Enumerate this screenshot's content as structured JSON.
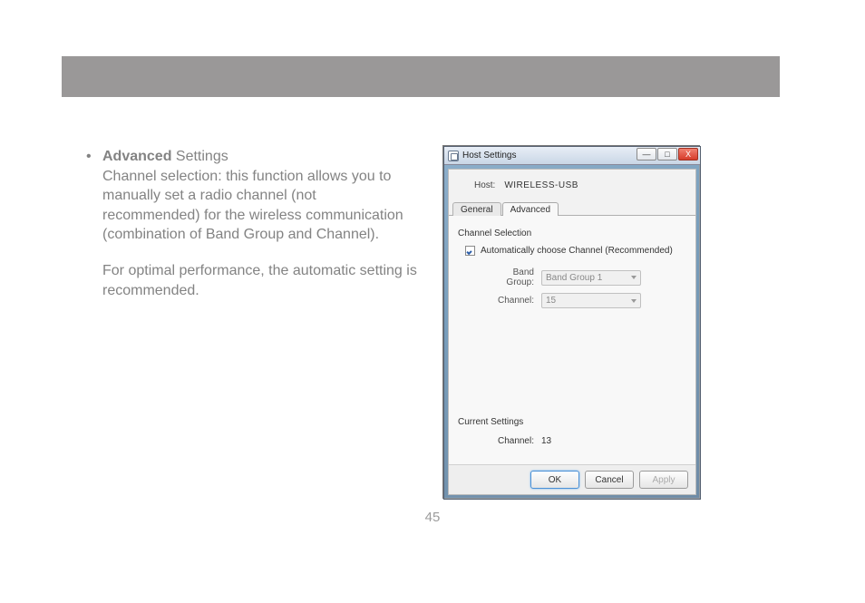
{
  "header_bar": "",
  "body": {
    "bullet": "•",
    "heading_strong": "Advanced",
    "heading_rest": " Settings",
    "para1": "Channel selection: this function allows you to manually set a radio channel (not recommended) for the wireless communication (combination of Band Group and Channel).",
    "para2": "For optimal performance, the automatic setting is recommended."
  },
  "page_number": "45",
  "dialog": {
    "title": "Host Settings",
    "win_min": "—",
    "win_max": "□",
    "win_close": "X",
    "host_label": "Host:",
    "host_value": "WIRELESS-USB",
    "tabs": {
      "general": "General",
      "advanced": "Advanced"
    },
    "section_channel": "Channel Selection",
    "auto_label": "Automatically choose Channel (Recommended)",
    "band_group_label": "Band Group:",
    "band_group_value": "Band Group 1",
    "channel_label": "Channel:",
    "channel_value": "15",
    "section_current": "Current Settings",
    "current_channel_label": "Channel:",
    "current_channel_value": "13",
    "buttons": {
      "ok": "OK",
      "cancel": "Cancel",
      "apply": "Apply"
    }
  }
}
